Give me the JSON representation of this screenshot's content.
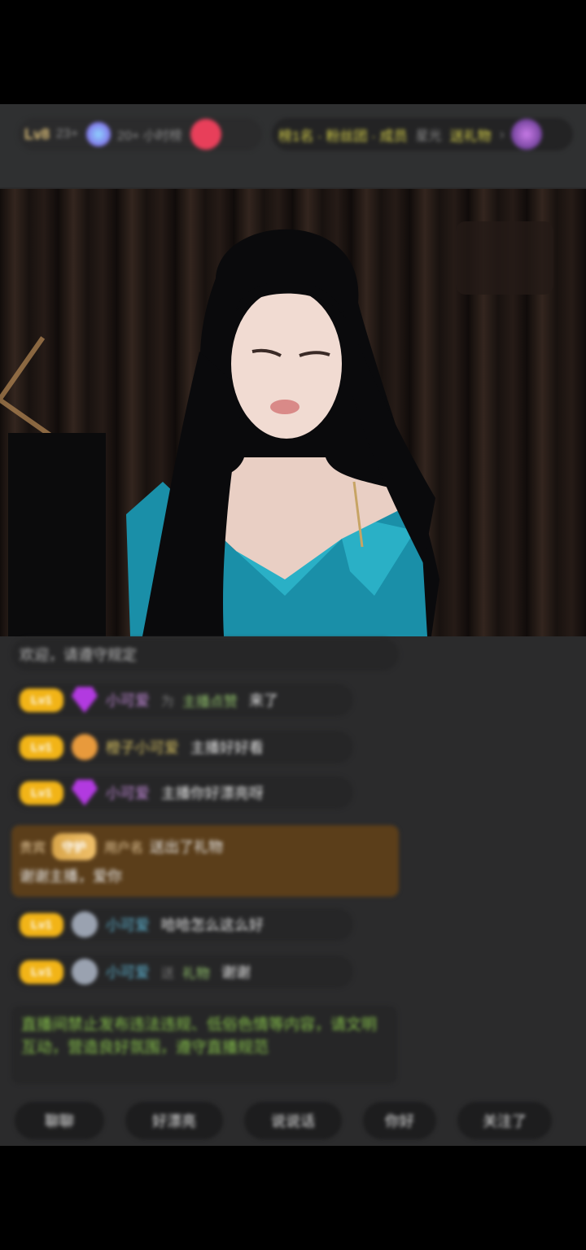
{
  "top_bar": {
    "level_badge": "Lv8",
    "viewer_count": "23+",
    "fans_text": "20+ 小时榜",
    "rank_text": "榜1名 · 粉丝团 · 成员",
    "activity": "星光",
    "cta": "送礼物"
  },
  "chat": {
    "notice": "欢迎，请遵守规定",
    "messages": [
      {
        "level": "Lv1",
        "name": "小可爱",
        "sep": "为",
        "target": "主播点赞",
        "text": "来了"
      },
      {
        "level": "Lv1",
        "name": "橙子小可爱",
        "text": "主播好好看"
      },
      {
        "level": "Lv1",
        "name": "小可爱",
        "text": "主播你好漂亮呀"
      },
      {
        "level": "Lv1",
        "name": "小可爱",
        "text": "哈哈怎么这么好"
      },
      {
        "level": "Lv1",
        "name": "小可爱",
        "sep": "送",
        "target": "礼物",
        "text": "谢谢"
      }
    ],
    "special": {
      "tag1": "贵宾",
      "tag2": "守护",
      "name": "用户名",
      "text_line1": "送出了礼物",
      "text_line2": "谢谢主播，爱你"
    },
    "system_msg": "直播间禁止发布违法违规、低俗色情等内容，请文明互动，营造良好氛围，遵守直播规范"
  },
  "quick_replies": [
    "聊聊",
    "好漂亮",
    "说说话",
    "你好",
    "关注了"
  ],
  "colors": {
    "background": "#2b2b2c",
    "level_badge": "#f2b417",
    "system_text": "#86c24a",
    "special_bg": "#5b3e1a"
  }
}
